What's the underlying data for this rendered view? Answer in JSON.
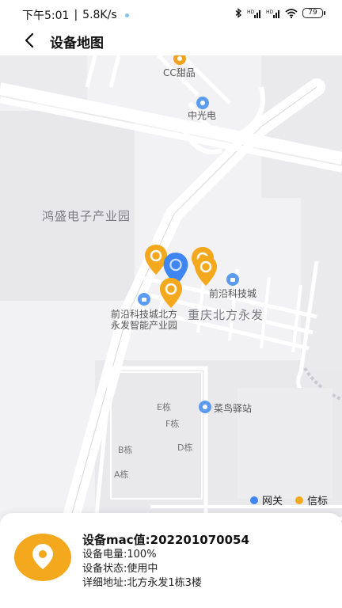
{
  "status_bar": {
    "time": "下午5:01",
    "separator": "|",
    "speed": "5.8K/s",
    "icons": [
      "bluetooth-icon",
      "signal-icon",
      "signal-icon",
      "wifi-icon"
    ],
    "battery": "79"
  },
  "header": {
    "back_icon": "chevron-left-icon",
    "title": "设备地图"
  },
  "map": {
    "labels": {
      "cc_dessert": "CC甜品",
      "zhongguangdian": "中光电",
      "hongsheng": "鸿盛电子产业园",
      "qianyan": "前沿科技城",
      "qianyan_beifang_1": "前沿科技城北方",
      "qianyan_beifang_2": "永发智能产业园",
      "chongqing_beifang": "重庆北方永发",
      "cainiao": "菜鸟驿站",
      "building_e": "E栋",
      "building_f": "F栋",
      "building_b": "B栋",
      "building_d": "D栋",
      "building_a": "A栋"
    },
    "markers": [
      {
        "type": "beacon",
        "color": "#f3a81e"
      },
      {
        "type": "gateway",
        "color": "#3f86f2"
      },
      {
        "type": "beacon",
        "color": "#f3a81e"
      },
      {
        "type": "beacon",
        "color": "#f3a81e"
      },
      {
        "type": "beacon",
        "color": "#f3a81e"
      }
    ],
    "legend": {
      "gateway_label": "网关",
      "gateway_color": "#3f86f2",
      "beacon_label": "信标",
      "beacon_color": "#f3a81e"
    }
  },
  "device_card": {
    "icon": "location-pin-icon",
    "mac_line": "设备mac值:202201070054",
    "battery_line": "设备电量:100%",
    "status_line": "设备状态:使用中",
    "address_line": "详细地址:北方永发1栋3楼"
  }
}
